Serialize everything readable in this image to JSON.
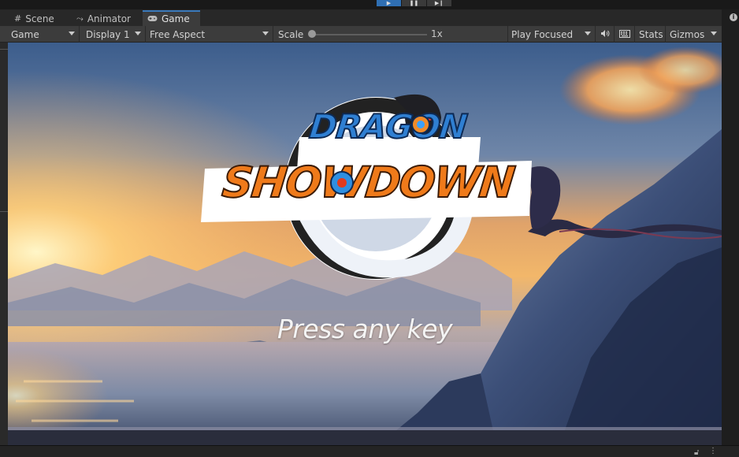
{
  "playbar": {
    "play": "▶",
    "pause": "❚❚",
    "step": "▶❙"
  },
  "tabs": [
    {
      "label": "Scene",
      "icon": "grid-icon"
    },
    {
      "label": "Animator",
      "icon": "animator-icon"
    },
    {
      "label": "Game",
      "icon": "gamepad-icon",
      "active": true
    }
  ],
  "toolbar": {
    "view_mode": "Game",
    "display": "Display 1",
    "aspect": "Free Aspect",
    "scale_label": "Scale",
    "scale_value": "1x",
    "scale_level": 0,
    "play_mode": "Play Focused",
    "stats": "Stats",
    "gizmos": "Gizmos"
  },
  "game": {
    "logo_line1": "DRAGON",
    "logo_line2": "SHOWDOWN",
    "prompt": "Press any key"
  },
  "colors": {
    "accent_tab": "#3a79bb",
    "play_active": "#2f6fb3",
    "logo_blue": "#2f7fd2",
    "logo_orange": "#ef7a1a"
  }
}
